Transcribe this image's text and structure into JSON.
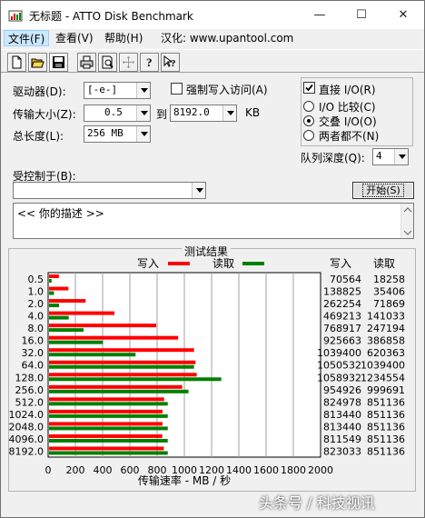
{
  "window": {
    "title": "无标题 - ATTO Disk Benchmark",
    "minimize": "—",
    "maximize": "☐",
    "close": "✕"
  },
  "menu": {
    "items": [
      "文件(F)",
      "查看(V)",
      "帮助(H)",
      "汉化: www.upantool.com"
    ]
  },
  "toolbar": {
    "icons": [
      "new-document-icon",
      "open-folder-icon",
      "save-icon",
      "print-icon",
      "print-preview-icon",
      "move-icon",
      "help-icon",
      "context-help-icon"
    ]
  },
  "form": {
    "drive_label": "驱动器(D):",
    "drive_value": "[-e-]",
    "force_write_label": "强制写入访问(A)",
    "force_write_checked": false,
    "transfer_label": "传输大小(Z):",
    "transfer_from": "0.5",
    "transfer_to_label": "到",
    "transfer_to": "8192.0",
    "transfer_unit": "KB",
    "total_label": "总长度(L):",
    "total_value": "256 MB",
    "direct_io_label": "直接 I/O(R)",
    "direct_io_checked": true,
    "io_compare_label": "I/O 比较(C)",
    "overlap_io_label": "交叠 I/O(O)",
    "neither_label": "两者都不(N)",
    "selected_io_mode": "overlap",
    "queue_label": "队列深度(Q):",
    "queue_value": "4",
    "controlled_by_label": "受控制于(B):",
    "controlled_by_value": "",
    "start_button": "开始(S)",
    "description": "<<  你的描述  >>"
  },
  "results": {
    "title": "测试结果",
    "write_legend": "写入",
    "read_legend": "读取",
    "write_header": "写入",
    "read_header": "读取",
    "x_axis_label": "传输速率 - MB / 秒"
  },
  "chart_data": {
    "type": "bar",
    "orientation": "horizontal",
    "categories": [
      "0.5",
      "1.0",
      "2.0",
      "4.0",
      "8.0",
      "16.0",
      "32.0",
      "64.0",
      "128.0",
      "256.0",
      "512.0",
      "1024.0",
      "2048.0",
      "4096.0",
      "8192.0"
    ],
    "series": [
      {
        "name": "写入",
        "color": "#ff0000",
        "values": [
          70564,
          138825,
          262254,
          469213,
          768917,
          925663,
          1039400,
          1050532,
          1058932,
          954926,
          824978,
          813440,
          813440,
          811549,
          823033
        ]
      },
      {
        "name": "读取",
        "color": "#008000",
        "values": [
          18258,
          35406,
          71869,
          141033,
          247194,
          386858,
          620363,
          1039400,
          1234554,
          999691,
          851136,
          851136,
          851136,
          851136,
          851136
        ]
      }
    ],
    "xlabel": "传输速率 - MB / 秒",
    "xlim": [
      0,
      2000
    ],
    "xticks": [
      "0",
      "200",
      "400",
      "600",
      "800",
      "1000",
      "1200",
      "1400",
      "1600",
      "1800",
      "2000"
    ],
    "grid": true,
    "legend": "top"
  },
  "watermark": "头条号 / 科技视讯"
}
